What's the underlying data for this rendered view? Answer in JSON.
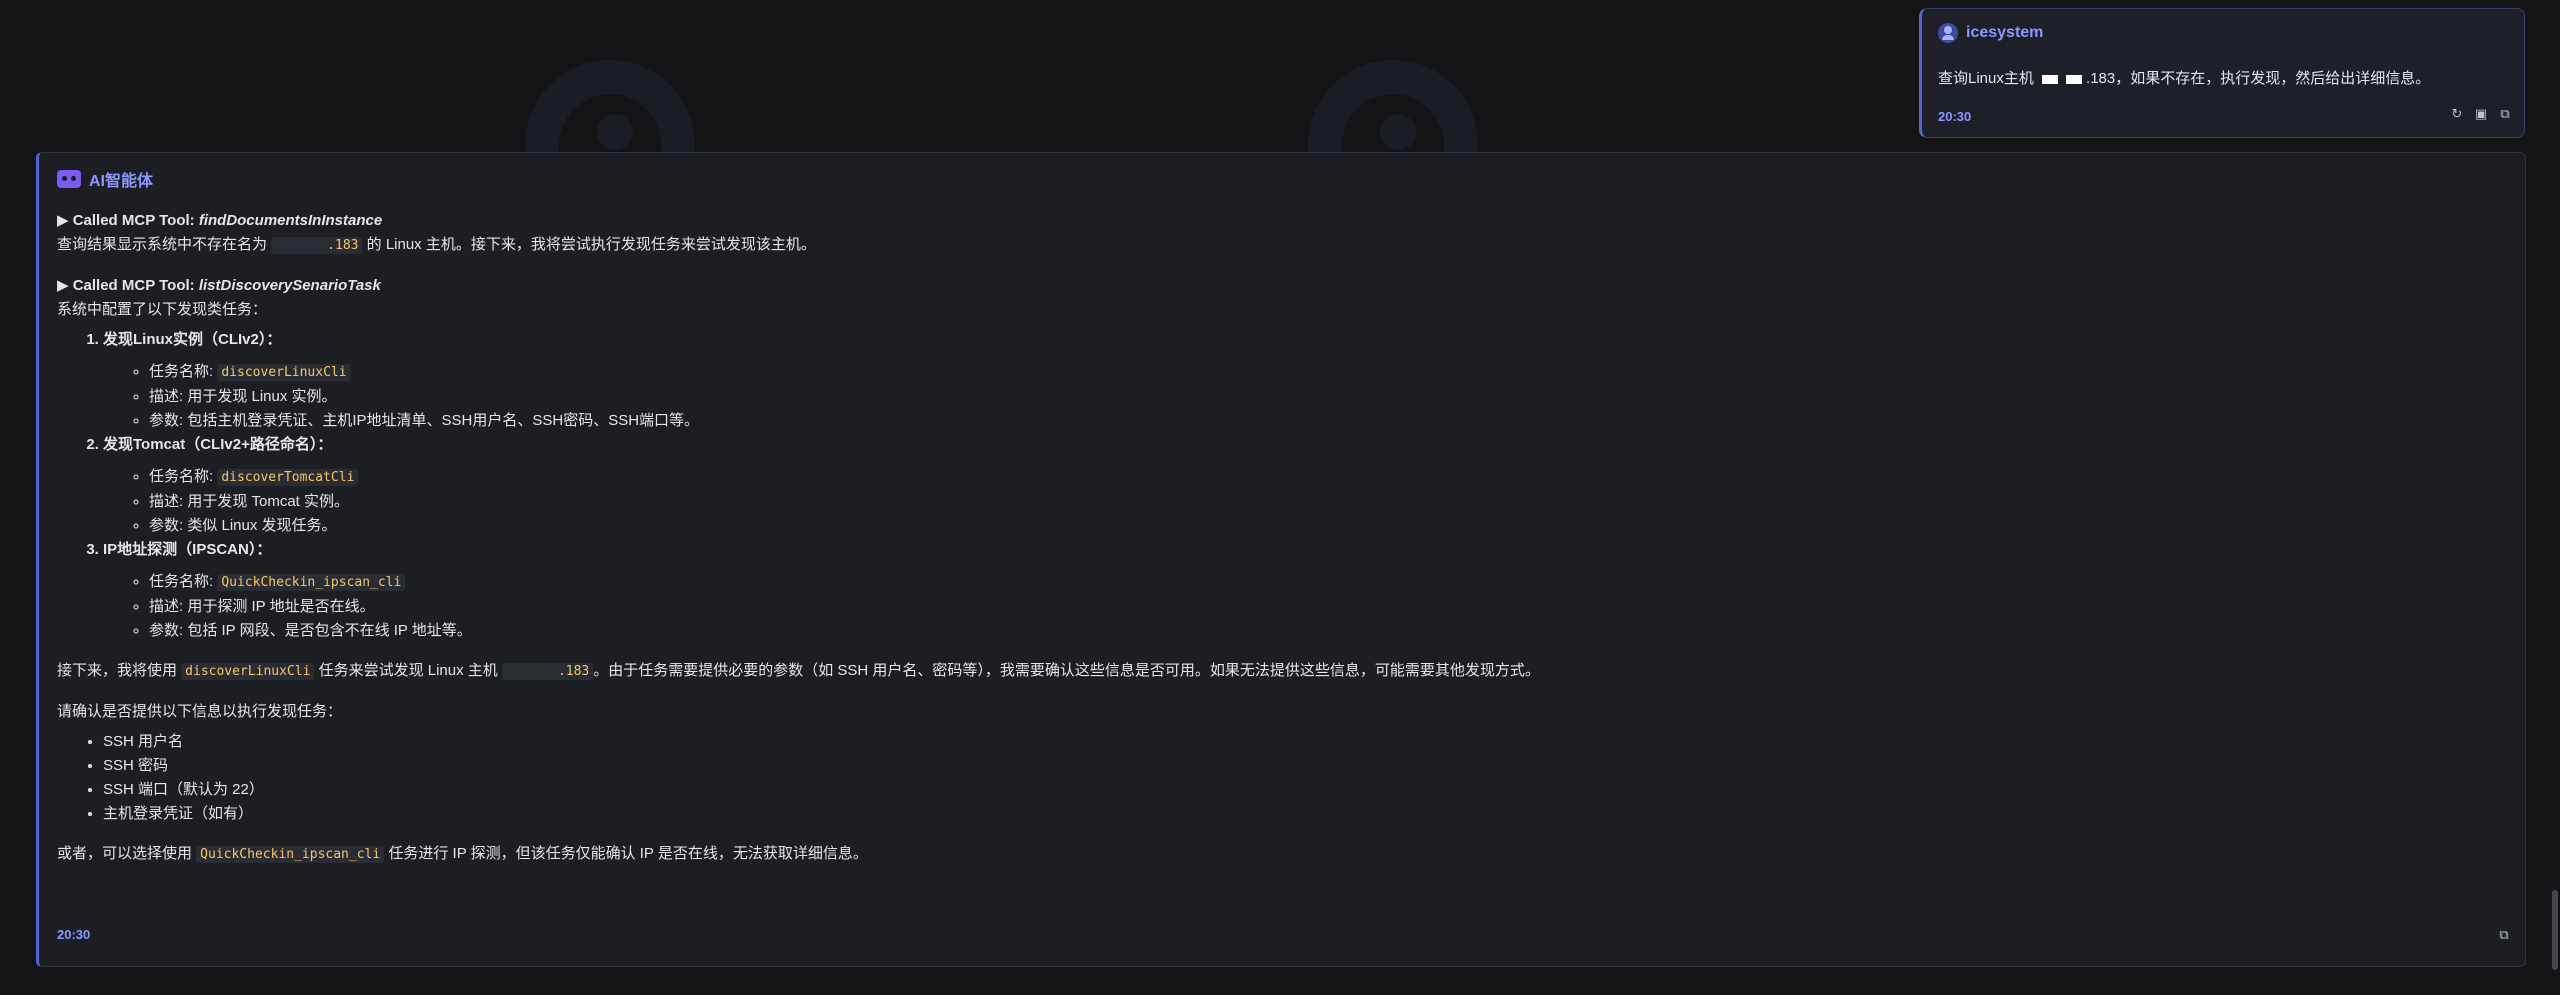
{
  "user_message": {
    "name": "icesystem",
    "text_before": "查询Linux主机 ",
    "text_after": ".183，如果不存在，执行发现，然后给出详细信息。",
    "time": "20:30"
  },
  "ai_message": {
    "name": "AI智能体",
    "tool1_prefix": "▶ Called MCP Tool: ",
    "tool1_name": "findDocumentsInInstance",
    "line1_before": "查询结果显示系统中不存在名为 ",
    "line1_ip": ".183",
    "line1_after": " 的 Linux 主机。接下来，我将尝试执行发现任务来尝试发现该主机。",
    "tool2_prefix": "▶ Called MCP Tool: ",
    "tool2_name": "listDiscoverySenarioTask",
    "line2": "系统中配置了以下发现类任务：",
    "tasks": [
      {
        "title": "发现Linux实例（CLIv2）：",
        "name_label": "任务名称: ",
        "name_code": "discoverLinuxCli",
        "desc": "描述: 用于发现 Linux 实例。",
        "params": "参数: 包括主机登录凭证、主机IP地址清单、SSH用户名、SSH密码、SSH端口等。"
      },
      {
        "title": "发现Tomcat（CLIv2+路径命名）：",
        "name_label": "任务名称: ",
        "name_code": "discoverTomcatCli",
        "desc": "描述: 用于发现 Tomcat 实例。",
        "params": "参数: 类似 Linux 发现任务。"
      },
      {
        "title": "IP地址探测（IPSCAN）：",
        "name_label": "任务名称: ",
        "name_code": "QuickCheckin_ipscan_cli",
        "desc": "描述: 用于探测 IP 地址是否在线。",
        "params": "参数: 包括 IP 网段、是否包含不在线 IP 地址等。"
      }
    ],
    "next_before": "接下来，我将使用 ",
    "next_code": "discoverLinuxCli",
    "next_mid": " 任务来尝试发现 Linux 主机 ",
    "next_ip": ".183",
    "next_after": "。由于任务需要提供必要的参数（如 SSH 用户名、密码等），我需要确认这些信息是否可用。如果无法提供这些信息，可能需要其他发现方式。",
    "confirm": "请确认是否提供以下信息以执行发现任务：",
    "required": [
      "SSH 用户名",
      "SSH 密码",
      "SSH 端口（默认为 22）",
      "主机登录凭证（如有）"
    ],
    "alt_before": "或者，可以选择使用 ",
    "alt_code": "QuickCheckin_ipscan_cli",
    "alt_after": " 任务进行 IP 探测，但该任务仅能确认 IP 是否在线，无法获取详细信息。",
    "time": "20:30"
  },
  "icons": {
    "user_avatar": "user-circle-icon",
    "ai_avatar": "robot-icon",
    "actions": [
      "refresh-icon",
      "image-icon",
      "copy-icon"
    ],
    "copy": "copy-icon"
  },
  "colors": {
    "accent": "#5a63d4",
    "accent_text": "#8d97ff",
    "code_text": "#f2c76b",
    "background": "#141416"
  }
}
